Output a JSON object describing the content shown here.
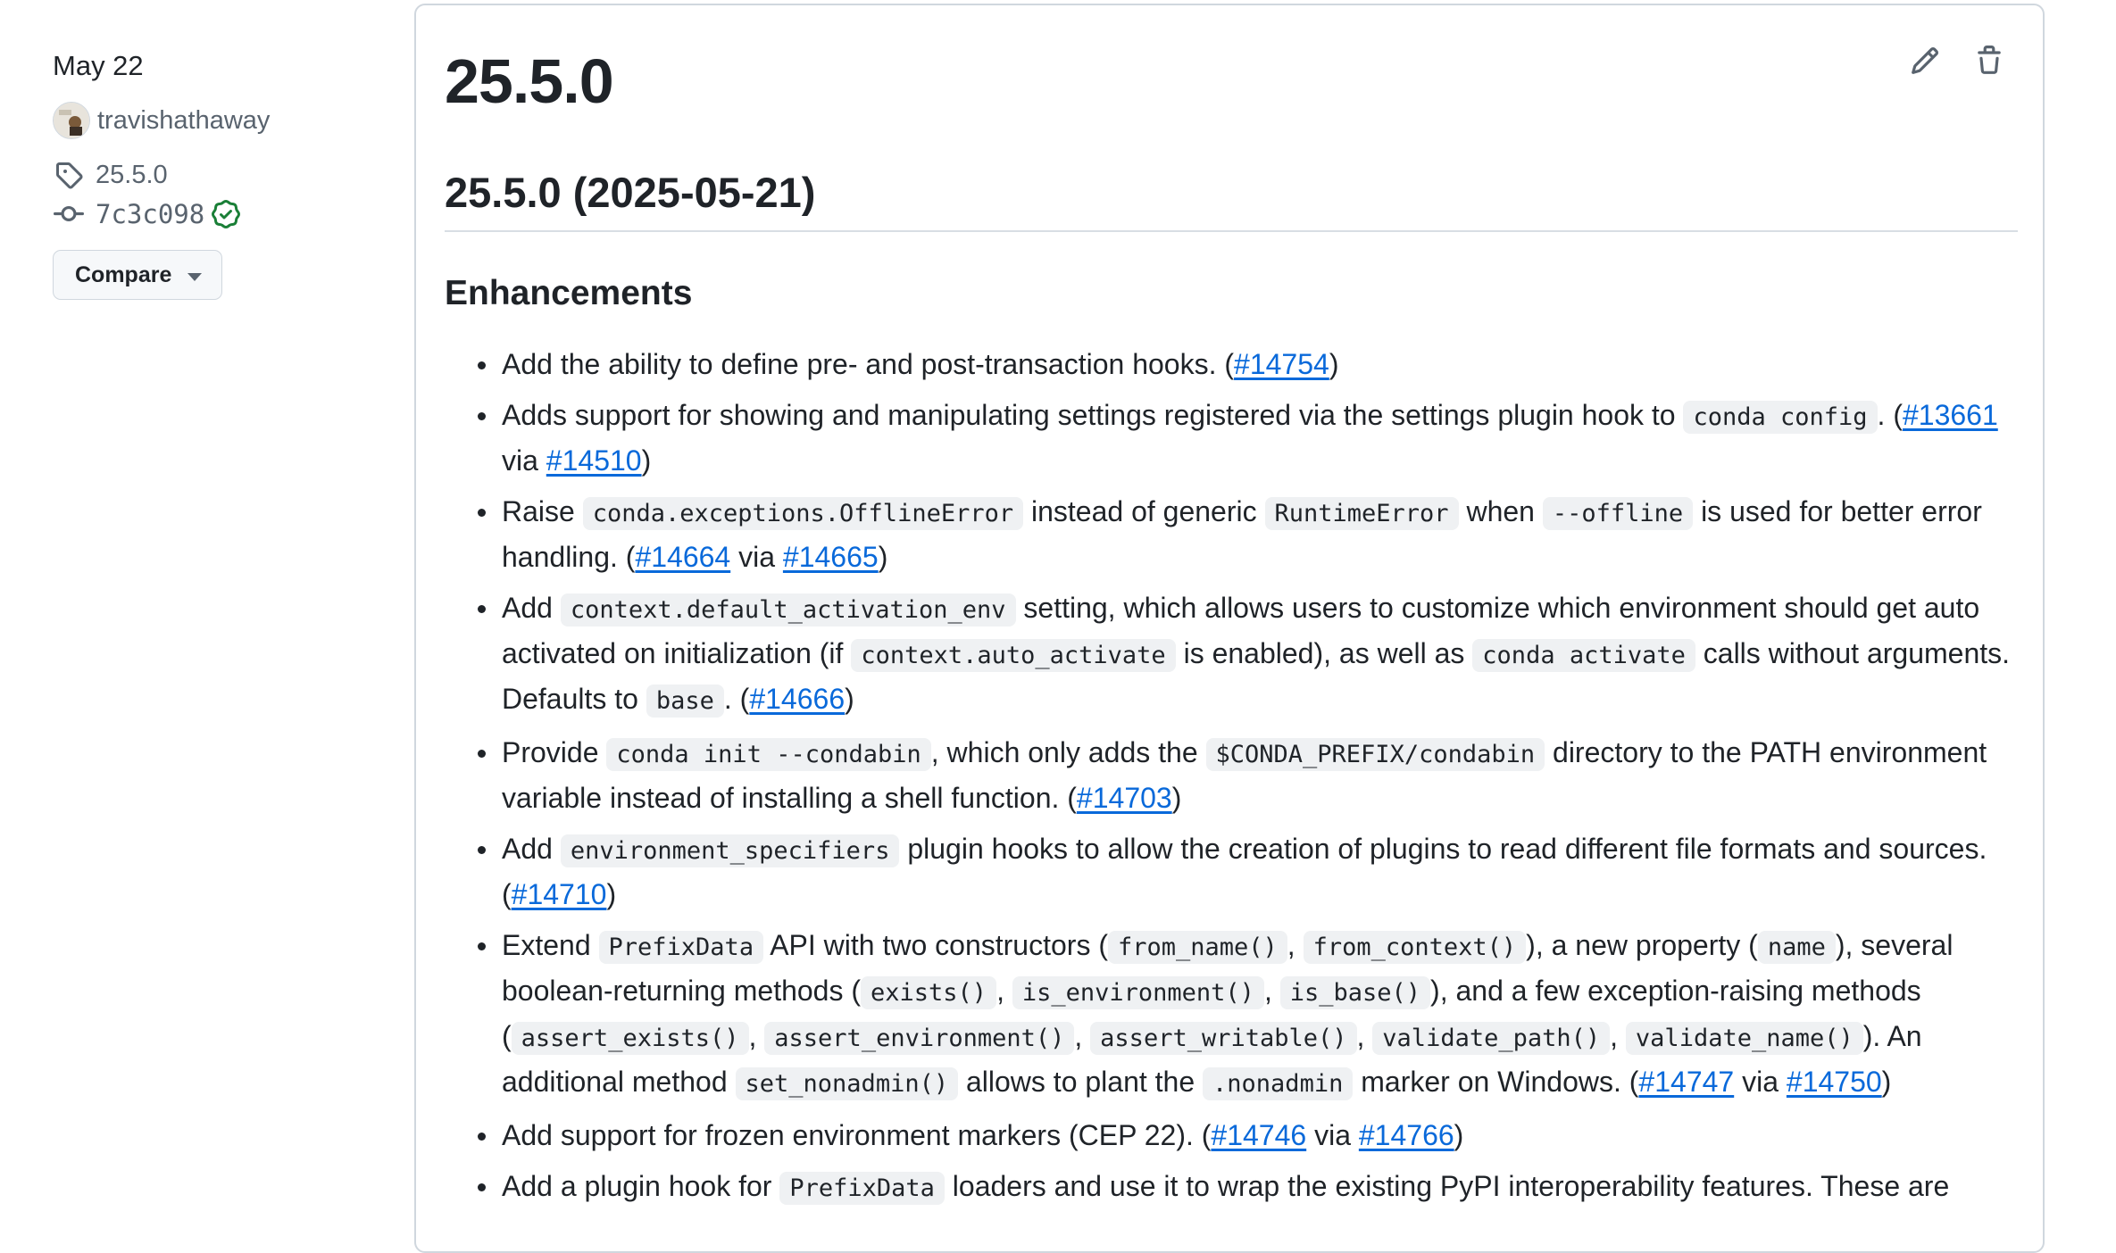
{
  "sidebar": {
    "date": "May 22",
    "author": "travishathaway",
    "tag": "25.5.0",
    "commit": "7c3c098",
    "compare_label": "Compare"
  },
  "release": {
    "title": "25.5.0",
    "subtitle": "25.5.0 (2025-05-21)",
    "section": "Enhancements",
    "items": [
      [
        {
          "t": "Add the ability to define pre- and post-transaction hooks. ("
        },
        {
          "a": "#14754"
        },
        {
          "t": ")"
        }
      ],
      [
        {
          "t": "Adds support for showing and manipulating settings registered via the settings plugin hook to "
        },
        {
          "c": "conda config"
        },
        {
          "t": ". ("
        },
        {
          "a": "#13661"
        },
        {
          "t": " via "
        },
        {
          "a": "#14510"
        },
        {
          "t": ")"
        }
      ],
      [
        {
          "t": "Raise "
        },
        {
          "c": "conda.exceptions.OfflineError"
        },
        {
          "t": " instead of generic "
        },
        {
          "c": "RuntimeError"
        },
        {
          "t": " when "
        },
        {
          "c": "--offline"
        },
        {
          "t": " is used for better error handling. ("
        },
        {
          "a": "#14664"
        },
        {
          "t": " via "
        },
        {
          "a": "#14665"
        },
        {
          "t": ")"
        }
      ],
      [
        {
          "t": "Add "
        },
        {
          "c": "context.default_activation_env"
        },
        {
          "t": " setting, which allows users to customize which environment should get auto activated on initialization (if "
        },
        {
          "c": "context.auto_activate"
        },
        {
          "t": " is enabled), as well as "
        },
        {
          "c": "conda activate"
        },
        {
          "t": " calls without arguments. Defaults to "
        },
        {
          "c": "base"
        },
        {
          "t": ". ("
        },
        {
          "a": "#14666"
        },
        {
          "t": ")"
        }
      ],
      [
        {
          "t": "Provide "
        },
        {
          "c": "conda init --condabin"
        },
        {
          "t": ", which only adds the "
        },
        {
          "c": "$CONDA_PREFIX/condabin"
        },
        {
          "t": " directory to the PATH environment variable instead of installing a shell function. ("
        },
        {
          "a": "#14703"
        },
        {
          "t": ")"
        }
      ],
      [
        {
          "t": "Add "
        },
        {
          "c": "environment_specifiers"
        },
        {
          "t": " plugin hooks to allow the creation of plugins to read different file formats and sources. ("
        },
        {
          "a": "#14710"
        },
        {
          "t": ")"
        }
      ],
      [
        {
          "t": "Extend "
        },
        {
          "c": "PrefixData"
        },
        {
          "t": " API with two constructors ("
        },
        {
          "c": "from_name()"
        },
        {
          "t": ", "
        },
        {
          "c": "from_context()"
        },
        {
          "t": "), a new property ("
        },
        {
          "c": "name"
        },
        {
          "t": "), several boolean-returning methods ("
        },
        {
          "c": "exists()"
        },
        {
          "t": ", "
        },
        {
          "c": "is_environment()"
        },
        {
          "t": ", "
        },
        {
          "c": "is_base()"
        },
        {
          "t": "), and a few exception-raising methods ("
        },
        {
          "c": "assert_exists()"
        },
        {
          "t": ", "
        },
        {
          "c": "assert_environment()"
        },
        {
          "t": ", "
        },
        {
          "c": "assert_writable()"
        },
        {
          "t": ", "
        },
        {
          "c": "validate_path()"
        },
        {
          "t": ", "
        },
        {
          "c": "validate_name()"
        },
        {
          "t": "). An additional method "
        },
        {
          "c": "set_nonadmin()"
        },
        {
          "t": " allows to plant the "
        },
        {
          "c": ".nonadmin"
        },
        {
          "t": " marker on Windows. ("
        },
        {
          "a": "#14747"
        },
        {
          "t": " via "
        },
        {
          "a": "#14750"
        },
        {
          "t": ")"
        }
      ],
      [
        {
          "t": "Add support for frozen environment markers (CEP 22). ("
        },
        {
          "a": "#14746"
        },
        {
          "t": " via "
        },
        {
          "a": "#14766"
        },
        {
          "t": ")"
        }
      ],
      [
        {
          "t": "Add a plugin hook for "
        },
        {
          "c": "PrefixData"
        },
        {
          "t": " loaders and use it to wrap the existing PyPI interoperability features. These are"
        }
      ]
    ]
  },
  "icons": {
    "edit": "pencil-icon",
    "delete": "trash-icon",
    "tag": "tag-icon",
    "commit": "git-commit-icon",
    "verified": "verified-check-icon"
  },
  "colors": {
    "link": "#0969da",
    "muted": "#59636e",
    "verified": "#1a7f37",
    "border": "#d0d7de",
    "code_bg": "#eff1f3"
  }
}
